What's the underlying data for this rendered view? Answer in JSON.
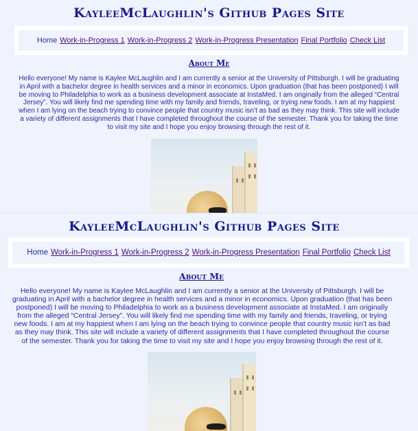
{
  "site": {
    "title": "KayleeMcLaughlin's Github Pages Site"
  },
  "nav": {
    "home": "Home",
    "links": [
      "Work-in-Progress 1",
      "Work-in-Progress 2",
      "Work-in-Progress Presentation",
      "Final Portfolio",
      "Check List"
    ]
  },
  "about": {
    "heading": "About Me",
    "text": "Hello everyone! My name is Kaylee McLaughlin and I am currently a senior at the University of Pittsburgh. I will be graduating in April with a bachelor degree in health services and a minor in economics. Upon graduation (that has been postponed) I will be moving to Philadelphia to work as a business development associate at InstaMed. I am originally from the alleged “Central Jersey”. You will likely find me spending time with my family and friends, traveling, or trying new foods. I am at my happiest when I am lying on the beach trying to convince people that country music isn’t as bad as they may think. This site will include a variety of different assignments that I have completed throughout the course of the semester. Thank you for taking the time to visit my site and I hope you enjoy browsing through the rest of it."
  },
  "colors": {
    "background": "#eef3fd",
    "title": "#1a1a8c",
    "text": "#2b2b9a",
    "link_visited": "#4b0f73",
    "nav_frame": "#ffffff"
  },
  "icons": {
    "photo": "profile-photo"
  }
}
